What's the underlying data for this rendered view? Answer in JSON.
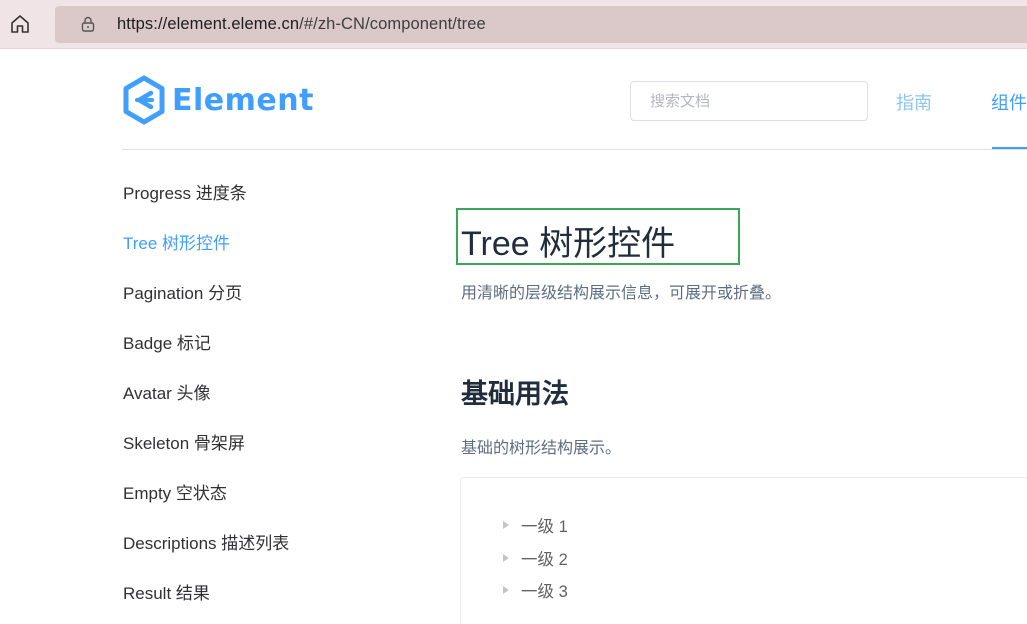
{
  "browser": {
    "url_host": "https://element.eleme.cn",
    "url_path": "/#/zh-CN/component/tree"
  },
  "header": {
    "logo_text": "Element",
    "search_placeholder": "搜索文档",
    "nav_guide": "指南",
    "nav_component": "组件"
  },
  "sidebar": {
    "items": [
      {
        "label": "Progress 进度条"
      },
      {
        "label": "Tree 树形控件"
      },
      {
        "label": "Pagination 分页"
      },
      {
        "label": "Badge 标记"
      },
      {
        "label": "Avatar 头像"
      },
      {
        "label": "Skeleton 骨架屏"
      },
      {
        "label": "Empty 空状态"
      },
      {
        "label": "Descriptions 描述列表"
      },
      {
        "label": "Result 结果"
      }
    ]
  },
  "main": {
    "title": "Tree 树形控件",
    "description": "用清晰的层级结构展示信息，可展开或折叠。",
    "section_title": "基础用法",
    "section_description": "基础的树形结构展示。",
    "tree_nodes": [
      {
        "label": "一级 1"
      },
      {
        "label": "一级 2"
      },
      {
        "label": "一级 3"
      }
    ]
  },
  "colors": {
    "accent": "#409eff",
    "highlight_border": "#3aa657"
  }
}
